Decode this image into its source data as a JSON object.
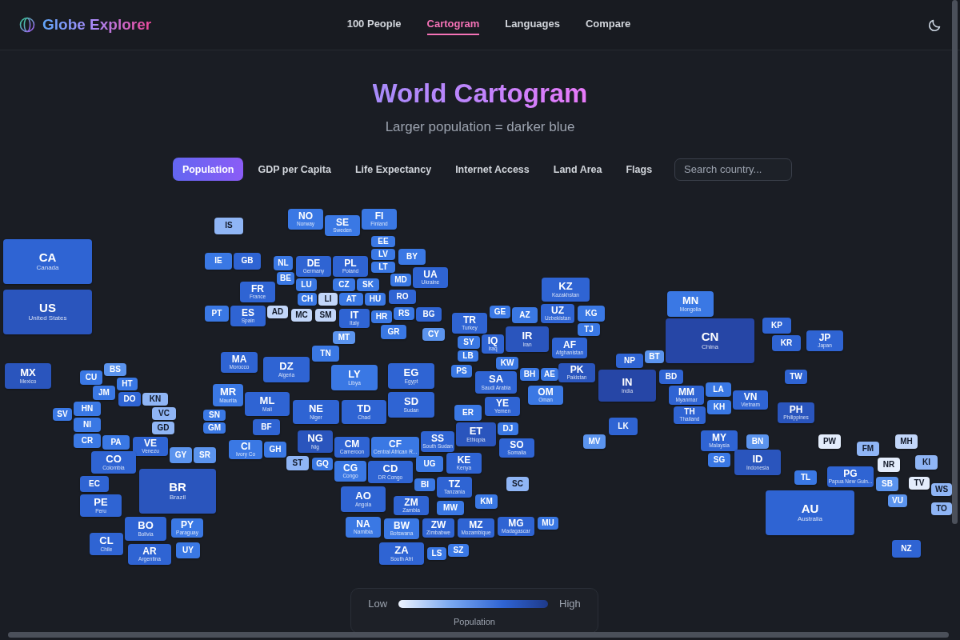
{
  "app": {
    "name": "Globe Explorer"
  },
  "nav": [
    {
      "label": "100 People",
      "selected": false
    },
    {
      "label": "Cartogram",
      "selected": true
    },
    {
      "label": "Languages",
      "selected": false
    },
    {
      "label": "Compare",
      "selected": false
    }
  ],
  "page": {
    "title": "World Cartogram",
    "subtitle": "Larger population = darker blue"
  },
  "metrics": [
    {
      "label": "Population",
      "selected": true
    },
    {
      "label": "GDP per Capita",
      "selected": false
    },
    {
      "label": "Life Expectancy",
      "selected": false
    },
    {
      "label": "Internet Access",
      "selected": false
    },
    {
      "label": "Land Area",
      "selected": false
    },
    {
      "label": "Flags",
      "selected": false
    }
  ],
  "search": {
    "placeholder": "Search country..."
  },
  "tiles": [
    {
      "code": "CA",
      "name": "Canada",
      "color": "#2f64d3"
    },
    {
      "code": "US",
      "name": "United States",
      "color": "#2a55bd"
    },
    {
      "code": "MX",
      "name": "Mexico",
      "color": "#2a55bd"
    },
    {
      "code": "BS",
      "color": "#5b94ee"
    },
    {
      "code": "CU",
      "color": "#3a78e4"
    },
    {
      "code": "HT",
      "color": "#3a78e4"
    },
    {
      "code": "JM",
      "color": "#3a78e4"
    },
    {
      "code": "DO",
      "color": "#2f64d3"
    },
    {
      "code": "KN",
      "color": "#8fb5f5"
    },
    {
      "code": "VC",
      "color": "#8fb5f5"
    },
    {
      "code": "GD",
      "color": "#8fb5f5"
    },
    {
      "code": "SV",
      "color": "#3a78e4"
    },
    {
      "code": "HN",
      "color": "#3a78e4"
    },
    {
      "code": "NI",
      "color": "#3a78e4"
    },
    {
      "code": "CR",
      "color": "#3a78e4"
    },
    {
      "code": "PA",
      "color": "#3a78e4"
    },
    {
      "code": "VE",
      "name": "Venezu",
      "color": "#2f64d3"
    },
    {
      "code": "GY",
      "color": "#5b94ee"
    },
    {
      "code": "SR",
      "color": "#5b94ee"
    },
    {
      "code": "CO",
      "name": "Colombia",
      "color": "#2f64d3"
    },
    {
      "code": "EC",
      "color": "#2f64d3"
    },
    {
      "code": "BR",
      "name": "Brazil",
      "color": "#2a55bd"
    },
    {
      "code": "PE",
      "name": "Peru",
      "color": "#2f64d3"
    },
    {
      "code": "BO",
      "name": "Bolivia",
      "color": "#2f64d3"
    },
    {
      "code": "PY",
      "name": "Paraguay",
      "color": "#3a78e4"
    },
    {
      "code": "CL",
      "name": "Chile",
      "color": "#2f64d3"
    },
    {
      "code": "AR",
      "name": "Argentina",
      "color": "#2f64d3"
    },
    {
      "code": "UY",
      "color": "#3a78e4"
    },
    {
      "code": "IS",
      "color": "#8fb5f5"
    },
    {
      "code": "NO",
      "name": "Norway",
      "color": "#3a78e4"
    },
    {
      "code": "SE",
      "name": "Sweden",
      "color": "#3a78e4"
    },
    {
      "code": "FI",
      "name": "Finland",
      "color": "#3a78e4"
    },
    {
      "code": "IE",
      "color": "#3a78e4"
    },
    {
      "code": "GB",
      "color": "#2f64d3"
    },
    {
      "code": "NL",
      "color": "#3a78e4"
    },
    {
      "code": "BE",
      "color": "#3a78e4"
    },
    {
      "code": "DE",
      "name": "Germany",
      "color": "#2f64d3"
    },
    {
      "code": "LU",
      "color": "#3a78e4"
    },
    {
      "code": "PL",
      "name": "Poland",
      "color": "#2f64d3"
    },
    {
      "code": "EE",
      "color": "#3a78e4"
    },
    {
      "code": "LV",
      "color": "#3a78e4"
    },
    {
      "code": "LT",
      "color": "#3a78e4"
    },
    {
      "code": "BY",
      "color": "#3a78e4"
    },
    {
      "code": "UA",
      "name": "Ukraine",
      "color": "#2f64d3"
    },
    {
      "code": "FR",
      "name": "France",
      "color": "#2f64d3"
    },
    {
      "code": "CZ",
      "color": "#3a78e4"
    },
    {
      "code": "SK",
      "color": "#3a78e4"
    },
    {
      "code": "MD",
      "color": "#3a78e4"
    },
    {
      "code": "CH",
      "color": "#3a78e4"
    },
    {
      "code": "LI",
      "color": "#c2d6f9"
    },
    {
      "code": "AT",
      "color": "#3a78e4"
    },
    {
      "code": "HU",
      "color": "#3a78e4"
    },
    {
      "code": "RO",
      "color": "#2f64d3"
    },
    {
      "code": "PT",
      "color": "#3a78e4"
    },
    {
      "code": "ES",
      "name": "Spain",
      "color": "#2f64d3"
    },
    {
      "code": "AD",
      "color": "#c2d6f9"
    },
    {
      "code": "MC",
      "color": "#c2d6f9"
    },
    {
      "code": "SM",
      "color": "#c2d6f9"
    },
    {
      "code": "IT",
      "name": "Italy",
      "color": "#2f64d3"
    },
    {
      "code": "HR",
      "color": "#3a78e4"
    },
    {
      "code": "RS",
      "color": "#3a78e4"
    },
    {
      "code": "BG",
      "color": "#2f64d3"
    },
    {
      "code": "GR",
      "color": "#3a78e4"
    },
    {
      "code": "MT",
      "color": "#5b94ee"
    },
    {
      "code": "CY",
      "color": "#5b94ee"
    },
    {
      "code": "TR",
      "name": "Turkey",
      "color": "#2f64d3"
    },
    {
      "code": "GE",
      "color": "#3a78e4"
    },
    {
      "code": "AZ",
      "color": "#3a78e4"
    },
    {
      "code": "KZ",
      "name": "Kazakhstan",
      "color": "#2f64d3"
    },
    {
      "code": "UZ",
      "name": "Uzbekistan",
      "color": "#2f64d3"
    },
    {
      "code": "KG",
      "color": "#3a78e4"
    },
    {
      "code": "TJ",
      "color": "#3a78e4"
    },
    {
      "code": "SY",
      "color": "#3a78e4"
    },
    {
      "code": "LB",
      "color": "#3a78e4"
    },
    {
      "code": "PS",
      "color": "#3a78e4"
    },
    {
      "code": "IQ",
      "name": "Iraq",
      "color": "#2f64d3"
    },
    {
      "code": "IR",
      "name": "Iran",
      "color": "#2a55bd"
    },
    {
      "code": "AF",
      "name": "Afghanistan",
      "color": "#2f64d3"
    },
    {
      "code": "KW",
      "color": "#3a78e4"
    },
    {
      "code": "SA",
      "name": "Saudi Arabia",
      "color": "#2f64d3"
    },
    {
      "code": "BH",
      "color": "#3a78e4"
    },
    {
      "code": "AE",
      "color": "#3a78e4"
    },
    {
      "code": "PK",
      "name": "Pakistan",
      "color": "#2a55bd"
    },
    {
      "code": "OM",
      "name": "Oman",
      "color": "#3a78e4"
    },
    {
      "code": "YE",
      "name": "Yemen",
      "color": "#2f64d3"
    },
    {
      "code": "NP",
      "color": "#2f64d3"
    },
    {
      "code": "BT",
      "color": "#5b94ee"
    },
    {
      "code": "IN",
      "name": "India",
      "color": "#2646a6"
    },
    {
      "code": "BD",
      "color": "#2f64d3"
    },
    {
      "code": "LK",
      "color": "#2f64d3"
    },
    {
      "code": "MV",
      "color": "#5b94ee"
    },
    {
      "code": "MN",
      "name": "Mongolia",
      "color": "#3a78e4"
    },
    {
      "code": "CN",
      "name": "China",
      "color": "#2646a6"
    },
    {
      "code": "KP",
      "color": "#2f64d3"
    },
    {
      "code": "KR",
      "color": "#2f64d3"
    },
    {
      "code": "JP",
      "name": "Japan",
      "color": "#2f64d3"
    },
    {
      "code": "TW",
      "color": "#2f64d3"
    },
    {
      "code": "MM",
      "name": "Myanmar",
      "color": "#2f64d3"
    },
    {
      "code": "LA",
      "color": "#3a78e4"
    },
    {
      "code": "VN",
      "name": "Vietnam",
      "color": "#2f64d3"
    },
    {
      "code": "TH",
      "name": "Thailand",
      "color": "#2f64d3"
    },
    {
      "code": "KH",
      "color": "#3a78e4"
    },
    {
      "code": "PH",
      "name": "Philippines",
      "color": "#2a55bd"
    },
    {
      "code": "MY",
      "name": "Malaysia",
      "color": "#2f64d3"
    },
    {
      "code": "SG",
      "color": "#3a78e4"
    },
    {
      "code": "BN",
      "color": "#5b94ee"
    },
    {
      "code": "ID",
      "name": "Indonesia",
      "color": "#2a55bd"
    },
    {
      "code": "TL",
      "color": "#3a78e4"
    },
    {
      "code": "PG",
      "name": "Papua New Guin...",
      "color": "#2f64d3"
    },
    {
      "code": "AU",
      "name": "Australia",
      "color": "#2f64d3"
    },
    {
      "code": "PW",
      "color": "#e4edfc"
    },
    {
      "code": "FM",
      "color": "#8fb5f5"
    },
    {
      "code": "MH",
      "color": "#c2d6f9"
    },
    {
      "code": "NR",
      "color": "#e4edfc"
    },
    {
      "code": "KI",
      "color": "#8fb5f5"
    },
    {
      "code": "SB",
      "color": "#5b94ee"
    },
    {
      "code": "TV",
      "color": "#e4edfc"
    },
    {
      "code": "WS",
      "color": "#8fb5f5"
    },
    {
      "code": "VU",
      "color": "#5b94ee"
    },
    {
      "code": "TO",
      "color": "#8fb5f5"
    },
    {
      "code": "NZ",
      "color": "#2f64d3"
    },
    {
      "code": "MA",
      "name": "Morocco",
      "color": "#2f64d3"
    },
    {
      "code": "DZ",
      "name": "Algeria",
      "color": "#2f64d3"
    },
    {
      "code": "TN",
      "color": "#3a78e4"
    },
    {
      "code": "LY",
      "name": "Libya",
      "color": "#3a78e4"
    },
    {
      "code": "EG",
      "name": "Egypt",
      "color": "#2f64d3"
    },
    {
      "code": "SD",
      "name": "Sudan",
      "color": "#2f64d3"
    },
    {
      "code": "MR",
      "name": "Maurita",
      "color": "#3a78e4"
    },
    {
      "code": "ML",
      "name": "Mali",
      "color": "#2f64d3"
    },
    {
      "code": "NE",
      "name": "Niger",
      "color": "#2f64d3"
    },
    {
      "code": "TD",
      "name": "Chad",
      "color": "#2f64d3"
    },
    {
      "code": "BF",
      "color": "#2f64d3"
    },
    {
      "code": "SN",
      "color": "#3a78e4"
    },
    {
      "code": "GM",
      "color": "#3a78e4"
    },
    {
      "code": "CI",
      "name": "Ivory Co",
      "color": "#3a78e4"
    },
    {
      "code": "GH",
      "color": "#3a78e4"
    },
    {
      "code": "NG",
      "name": "Nig",
      "color": "#2a55bd"
    },
    {
      "code": "ST",
      "color": "#8fb5f5"
    },
    {
      "code": "CM",
      "name": "Cameroon",
      "color": "#2f64d3"
    },
    {
      "code": "CF",
      "name": "Central African R...",
      "color": "#3a78e4"
    },
    {
      "code": "SS",
      "name": "South Sudan",
      "color": "#2f64d3"
    },
    {
      "code": "ER",
      "color": "#3a78e4"
    },
    {
      "code": "ET",
      "name": "Ethiopia",
      "color": "#2a55bd"
    },
    {
      "code": "DJ",
      "color": "#3a78e4"
    },
    {
      "code": "SO",
      "name": "Somalia",
      "color": "#2f64d3"
    },
    {
      "code": "GQ",
      "color": "#3a78e4"
    },
    {
      "code": "CG",
      "name": "Congo",
      "color": "#3a78e4"
    },
    {
      "code": "CD",
      "name": "DR Congo",
      "color": "#2f64d3"
    },
    {
      "code": "AO",
      "name": "Angola",
      "color": "#2f64d3"
    },
    {
      "code": "UG",
      "color": "#3a78e4"
    },
    {
      "code": "KE",
      "name": "Kenya",
      "color": "#2f64d3"
    },
    {
      "code": "BI",
      "color": "#3a78e4"
    },
    {
      "code": "TZ",
      "name": "Tanzania",
      "color": "#2f64d3"
    },
    {
      "code": "SC",
      "color": "#8fb5f5"
    },
    {
      "code": "ZM",
      "name": "Zambia",
      "color": "#2f64d3"
    },
    {
      "code": "MW",
      "color": "#3a78e4"
    },
    {
      "code": "KM",
      "color": "#3a78e4"
    },
    {
      "code": "NA",
      "name": "Namibia",
      "color": "#3a78e4"
    },
    {
      "code": "BW",
      "name": "Botswana",
      "color": "#3a78e4"
    },
    {
      "code": "ZW",
      "name": "Zimbabwe",
      "color": "#2f64d3"
    },
    {
      "code": "MZ",
      "name": "Mozambique",
      "color": "#2f64d3"
    },
    {
      "code": "MG",
      "name": "Madagascar",
      "color": "#2f64d3"
    },
    {
      "code": "MU",
      "color": "#3a78e4"
    },
    {
      "code": "ZA",
      "name": "South Afri",
      "color": "#2f64d3"
    },
    {
      "code": "LS",
      "color": "#3a78e4"
    },
    {
      "code": "SZ",
      "color": "#3a78e4"
    }
  ],
  "legend": {
    "low": "Low",
    "high": "High",
    "label": "Population"
  }
}
